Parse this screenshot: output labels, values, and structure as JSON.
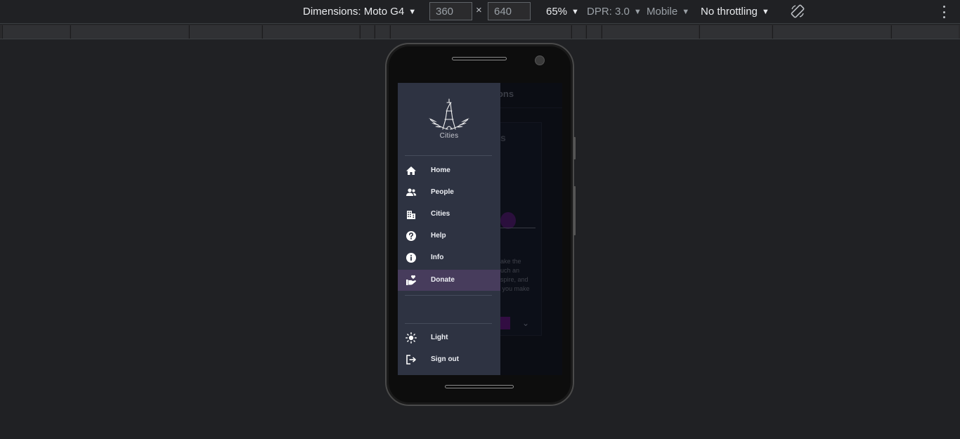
{
  "toolbar": {
    "dimensions_label": "Dimensions: Moto G4",
    "width": "360",
    "height": "640",
    "times": "×",
    "zoom": "65%",
    "dpr": "DPR: 3.0",
    "mobile": "Mobile",
    "throttling": "No throttling",
    "caret": "▼"
  },
  "background_page": {
    "header_title": "tions",
    "card_title": "s",
    "paragraph": "ake the\nuch an\nspire, and\n you make",
    "chevron": "⌄"
  },
  "drawer": {
    "logo_text": "Cities",
    "nav_items": [
      {
        "label": "Home",
        "icon": "home-icon"
      },
      {
        "label": "People",
        "icon": "people-icon"
      },
      {
        "label": "Cities",
        "icon": "city-icon"
      },
      {
        "label": "Help",
        "icon": "help-icon"
      },
      {
        "label": "Info",
        "icon": "info-icon"
      },
      {
        "label": "Donate",
        "icon": "donate-icon",
        "active": true
      }
    ],
    "bottom_items": [
      {
        "label": "Light",
        "icon": "sun-icon"
      },
      {
        "label": "Sign out",
        "icon": "sign-out-icon"
      }
    ]
  },
  "colors": {
    "drawer_bg": "#2e3342",
    "active_item_bg": "#473c5c",
    "accent": "#6a1a8c"
  }
}
